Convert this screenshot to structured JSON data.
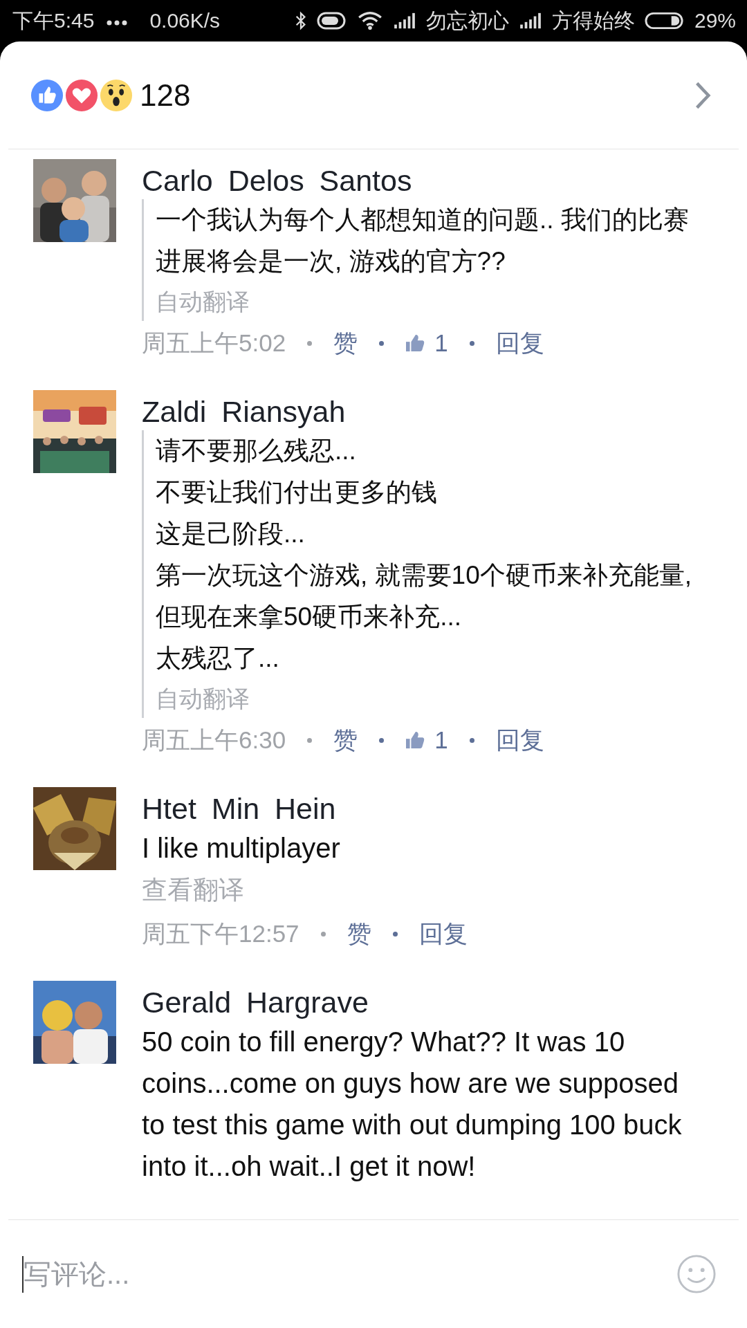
{
  "status_bar": {
    "time": "下午5:45",
    "speed": "0.06K/s",
    "carrier_1": "勿忘初心",
    "carrier_2": "方得始终",
    "battery": "29%"
  },
  "reactions": {
    "count": "128"
  },
  "comments": [
    {
      "author": "Carlo Delos Santos",
      "body": [
        "一个我认为每个人都想知道的问题.. 我们的比赛进展将会是一次, 游戏的官方??"
      ],
      "translated": true,
      "translation_label": "自动翻译",
      "time": "周五上午5:02",
      "like_label": "赞",
      "likes": "1",
      "reply_label": "回复"
    },
    {
      "author": "Zaldi Riansyah",
      "body": [
        "请不要那么残忍...",
        "不要让我们付出更多的钱",
        "这是己阶段...",
        "第一次玩这个游戏, 就需要10个硬币来补充能量, 但现在来拿50硬币来补充...",
        "太残忍了..."
      ],
      "translated": true,
      "translation_label": "自动翻译",
      "time": "周五上午6:30",
      "like_label": "赞",
      "likes": "1",
      "reply_label": "回复"
    },
    {
      "author": "Htet Min Hein",
      "body": [
        "I like multiplayer"
      ],
      "translated": false,
      "translation_label": "查看翻译",
      "time": "周五下午12:57",
      "like_label": "赞",
      "reply_label": "回复"
    },
    {
      "author": "Gerald Hargrave",
      "body": [
        "50 coin to fill energy? What?? It was 10 coins...come on guys how are we supposed to test this game with out dumping 100 buck into it...oh wait..I get it now!"
      ],
      "translated": false
    }
  ],
  "composer": {
    "placeholder": "写评论..."
  }
}
